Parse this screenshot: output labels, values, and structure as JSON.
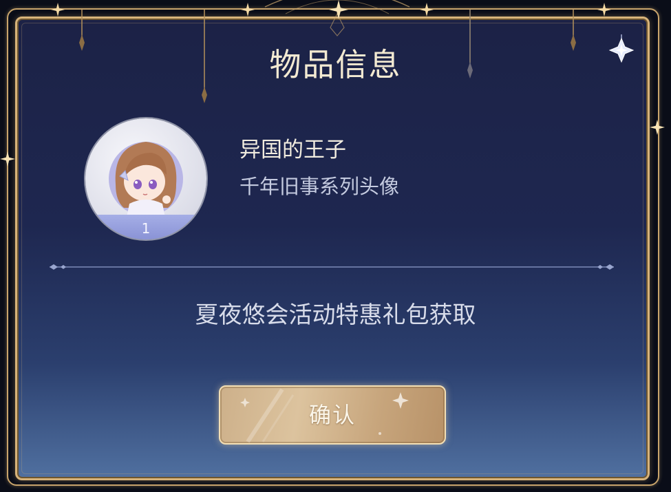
{
  "dialog": {
    "title": "物品信息",
    "close_icon": "close-star-icon"
  },
  "item": {
    "name": "异国的王子",
    "type": "千年旧事系列头像",
    "count": "1",
    "avatar_icon": "chibi-character-portrait"
  },
  "source_text": "夏夜悠会活动特惠礼包获取",
  "confirm_button": {
    "label": "确认"
  },
  "colors": {
    "frame_gold": "#d7b37a",
    "panel_navy": "#1e2750",
    "button_gold": "#d3b893"
  }
}
